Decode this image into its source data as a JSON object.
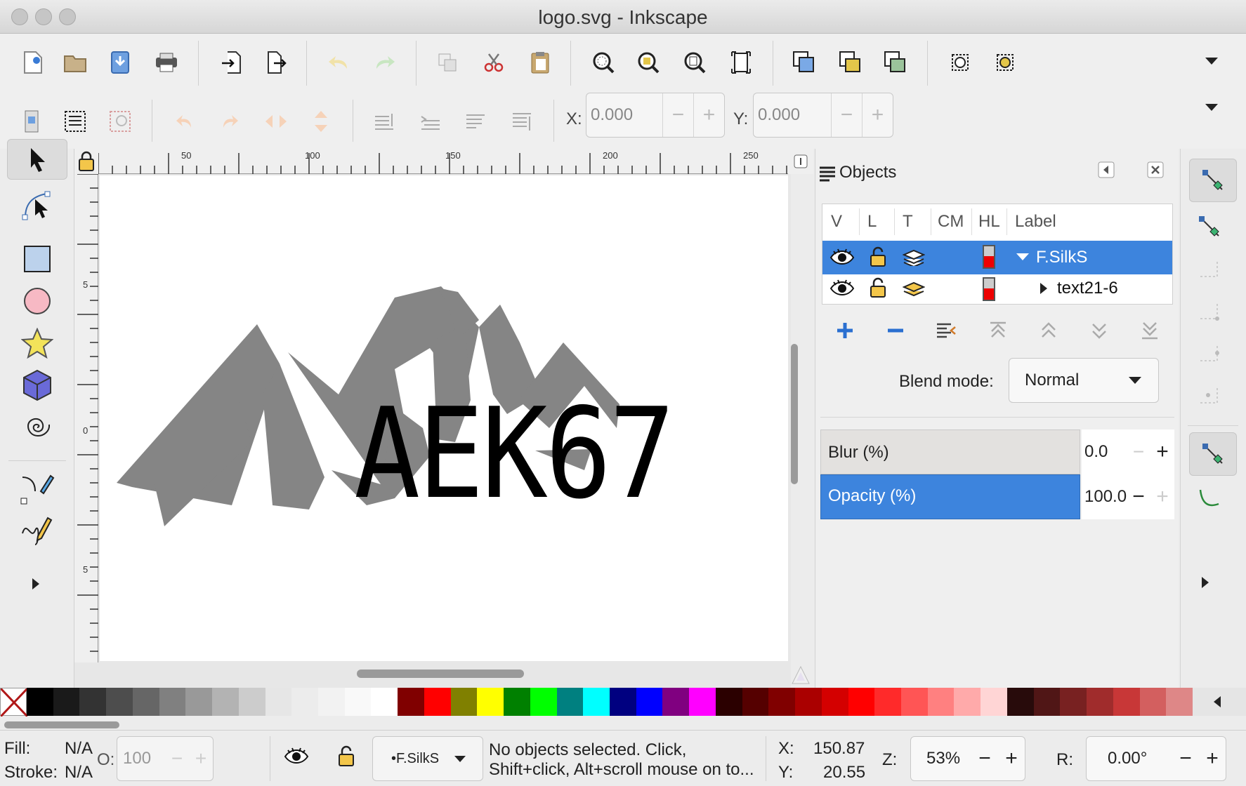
{
  "window": {
    "title": "logo.svg - Inkscape"
  },
  "controls": {
    "x_label": "X:",
    "x_value": "0.000",
    "y_label": "Y:",
    "y_value": "0.000",
    "minus": "−",
    "plus": "+"
  },
  "ruler": {
    "labels": [
      "50",
      "100",
      "150",
      "200",
      "250"
    ],
    "vlabels": [
      "5",
      "0",
      "5"
    ]
  },
  "canvas": {
    "logo_text": "AEK67"
  },
  "objects_panel": {
    "title": "Objects",
    "columns": [
      "V",
      "L",
      "T",
      "CM",
      "HL",
      "Label"
    ],
    "rows": [
      {
        "label": "F.SilkS",
        "selected": true,
        "expanded": true
      },
      {
        "label": "text21-6",
        "selected": false,
        "expanded": false
      }
    ],
    "blend_label": "Blend mode:",
    "blend_value": "Normal",
    "blur_label": "Blur (%)",
    "blur_value": "0.0",
    "opacity_label": "Opacity (%)",
    "opacity_value": "100.0"
  },
  "palette": {
    "colors": [
      "#000000",
      "#1a1a1a",
      "#333333",
      "#4d4d4d",
      "#666666",
      "#808080",
      "#999999",
      "#b3b3b3",
      "#cccccc",
      "#e6e6e6",
      "#ececec",
      "#f2f2f2",
      "#f9f9f9",
      "#ffffff",
      "#800000",
      "#ff0000",
      "#808000",
      "#ffff00",
      "#008000",
      "#00ff00",
      "#008080",
      "#00ffff",
      "#000080",
      "#0000ff",
      "#800080",
      "#ff00ff",
      "#2b0000",
      "#550000",
      "#800000",
      "#aa0000",
      "#d40000",
      "#ff0000",
      "#ff2a2a",
      "#ff5555",
      "#ff8080",
      "#ffaaaa",
      "#ffd5d5",
      "#280b0b",
      "#501616",
      "#782121",
      "#a02c2c",
      "#c83737",
      "#d35f5f",
      "#de8787"
    ]
  },
  "status": {
    "fill_label": "Fill:",
    "fill_value": "N/A",
    "stroke_label": "Stroke:",
    "stroke_value": "N/A",
    "opacity_label": "O:",
    "opacity_value": "100",
    "layer_name": "•F.SilkS",
    "message_line1": "No objects selected. Click,",
    "message_line2": "Shift+click, Alt+scroll mouse on to...",
    "x_label": "X:",
    "x_value": "150.87",
    "y_label": "Y:",
    "y_value": "20.55",
    "zoom_label": "Z:",
    "zoom_value": "53%",
    "rotate_label": "R:",
    "rotate_value": "0.00°"
  }
}
